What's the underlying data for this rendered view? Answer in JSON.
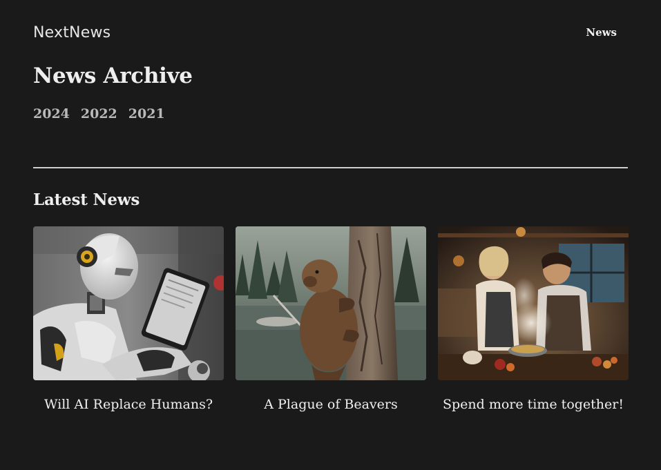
{
  "header": {
    "logo": "NextNews",
    "nav": [
      "News"
    ]
  },
  "page": {
    "title": "News Archive",
    "years": [
      "2024",
      "2022",
      "2021"
    ]
  },
  "latest": {
    "heading": "Latest News",
    "articles": [
      {
        "title": "Will AI Replace Humans?"
      },
      {
        "title": "A Plague of Beavers"
      },
      {
        "title": "Spend more time together!"
      }
    ]
  }
}
